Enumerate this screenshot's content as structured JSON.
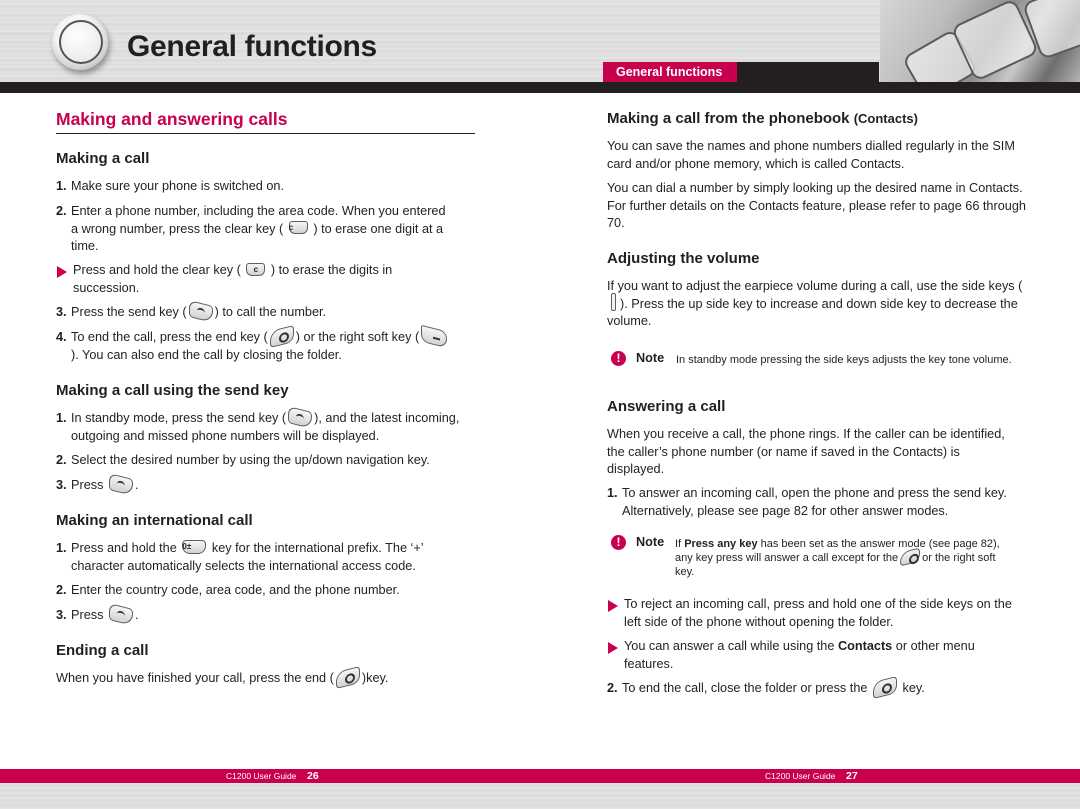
{
  "header": {
    "title": "General functions",
    "section_tab": "General functions"
  },
  "left": {
    "chapter_title": "Making and answering calls",
    "making_call": {
      "heading": "Making a call",
      "step1_num": "1.",
      "step1": "Make sure your phone is switched on.",
      "step2_num": "2.",
      "step2_a": "Enter a phone number, including the area code. When you entered a wrong number, press the clear key (",
      "step2_b": ") to erase one digit at a time.",
      "bullet_a": "Press and hold the clear key (",
      "bullet_b": ") to erase the digits in succession.",
      "step3_num": "3.",
      "step3_a": "Press the send key (",
      "step3_b": ") to call the number.",
      "step4_num": "4.",
      "step4_a": "To end the call, press the end key (",
      "step4_b": ") or the right soft key (",
      "step4_c": "). You can also end the call by closing the folder."
    },
    "send_key": {
      "heading": "Making a call using the send key",
      "step1_num": "1.",
      "step1_a": "In standby mode, press the send key (",
      "step1_b": "), and the latest incoming, outgoing and missed phone numbers will be displayed.",
      "step2_num": "2.",
      "step2": "Select the desired number by using the up/down navigation key.",
      "step3_num": "3.",
      "step3_a": "Press",
      "step3_b": "."
    },
    "international": {
      "heading": "Making an international call",
      "step1_num": "1.",
      "step1_a": "Press and hold the",
      "step1_b": "key for the international prefix. The ‘+’ character automatically selects the international access code.",
      "step2_num": "2.",
      "step2": "Enter the country code, area code, and the phone number.",
      "step3_num": "3.",
      "step3_a": "Press",
      "step3_b": "."
    },
    "ending": {
      "heading": "Ending a call",
      "text_a": "When you have finished your call, press the end (",
      "text_b": ")key."
    }
  },
  "right": {
    "phonebook": {
      "heading": "Making a call from the phonebook",
      "heading_small": "(Contacts)",
      "para1": "You can save the names and phone numbers dialled regularly in the SIM card and/or phone memory, which is called Contacts.",
      "para2": "You can dial a number by simply looking up the desired name in Contacts. For further details on the Contacts feature, please refer to page 66 through 70."
    },
    "volume": {
      "heading": "Adjusting the volume",
      "para_a": "If you want to adjust the earpiece volume during a call, use the side keys (",
      "para_b": "). Press the up side key to increase and down side key to decrease the volume.",
      "note_label": "Note",
      "note_text": "In standby mode pressing the side keys adjusts the key tone volume."
    },
    "answering": {
      "heading": "Answering a call",
      "para": "When you receive a call, the phone rings. If the caller can be identified, the caller’s phone number (or name if saved in the Contacts) is displayed.",
      "step1_num": "1.",
      "step1": "To answer an incoming call, open the phone and press the send key. Alternatively, please see page 82 for other answer modes.",
      "note_label": "Note",
      "note_a": "If",
      "note_bold": "Press any key",
      "note_b": "has been set as the answer mode (see page 82), any key press will answer a call except for the",
      "note_c": "or the right soft key.",
      "bullet1": "To reject an incoming call, press and hold one of the side keys on the left side of the phone without opening the folder.",
      "bullet2_a": "You can answer a call while using the",
      "bullet2_bold": "Contacts",
      "bullet2_b": "or other menu features.",
      "step2_num": "2.",
      "step2_a": "To end the call, close the folder or press the",
      "step2_b": "key."
    }
  },
  "keys": {
    "clear": "c",
    "zero": "0±"
  },
  "footer": {
    "left_label": "C1200 User Guide",
    "left_page": "26",
    "right_label": "C1200 User Guide",
    "right_page": "27"
  },
  "colors": {
    "accent": "#c8004f",
    "text": "#231f20",
    "header_bar": "#231f20"
  }
}
